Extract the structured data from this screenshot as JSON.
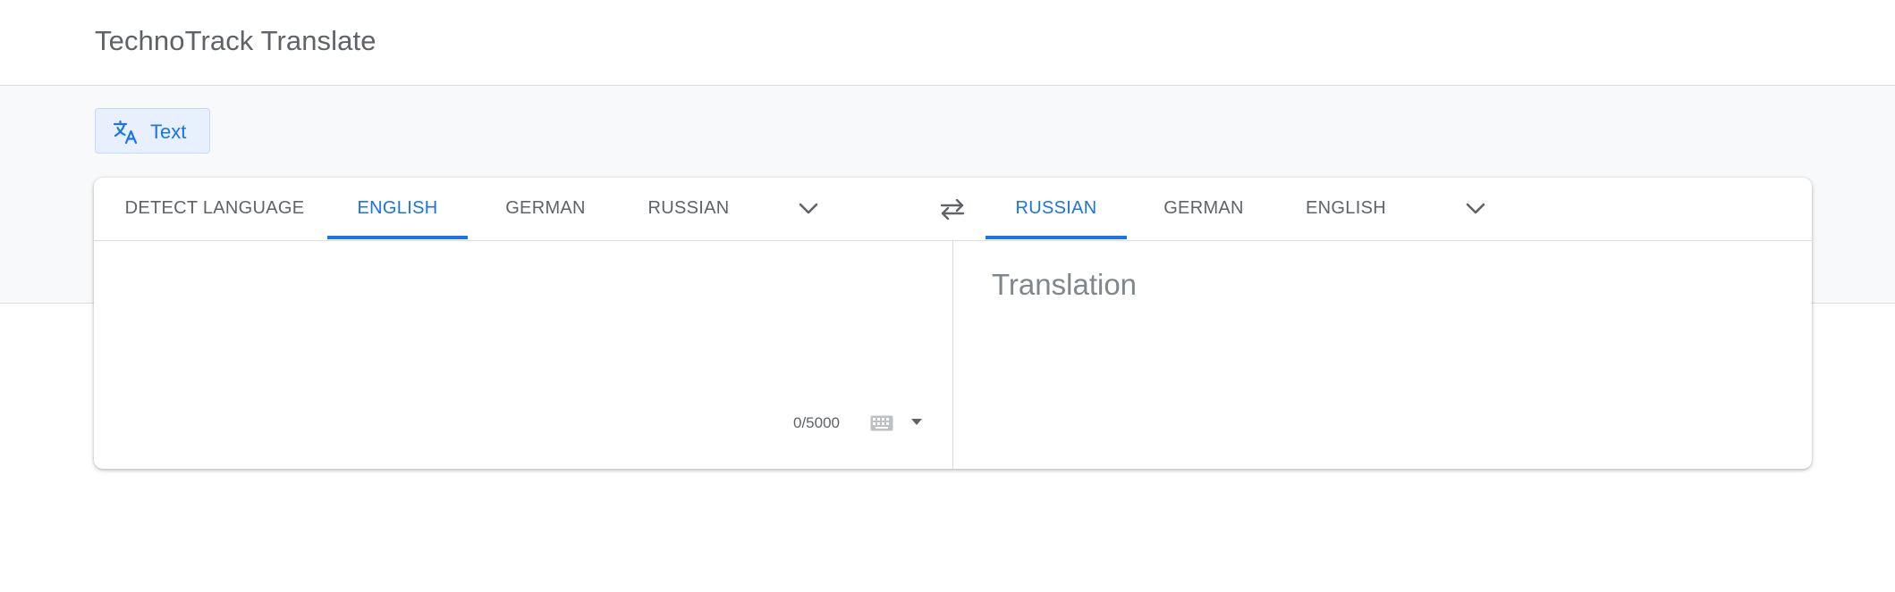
{
  "app": {
    "title": "TechnoTrack Translate"
  },
  "mode": {
    "label": "Text",
    "icon": "translate-icon"
  },
  "source_languages": {
    "tabs": [
      {
        "label": "DETECT LANGUAGE",
        "active": false
      },
      {
        "label": "ENGLISH",
        "active": true
      },
      {
        "label": "GERMAN",
        "active": false
      },
      {
        "label": "RUSSIAN",
        "active": false
      }
    ],
    "more_icon": "chevron-down-icon"
  },
  "swap": {
    "icon": "swap-arrows-icon"
  },
  "target_languages": {
    "tabs": [
      {
        "label": "RUSSIAN",
        "active": true
      },
      {
        "label": "GERMAN",
        "active": false
      },
      {
        "label": "ENGLISH",
        "active": false
      }
    ],
    "more_icon": "chevron-down-icon"
  },
  "source": {
    "value": "",
    "char_count": "0/5000",
    "keyboard_icon": "keyboard-icon",
    "keyboard_menu_icon": "caret-down-icon"
  },
  "target": {
    "placeholder": "Translation"
  },
  "colors": {
    "accent": "#1a73e8",
    "active_chip_bg": "#e8f0fe",
    "band_bg": "#f8f9fa",
    "tab_text": "#5f6368",
    "placeholder_text": "#80868b"
  }
}
